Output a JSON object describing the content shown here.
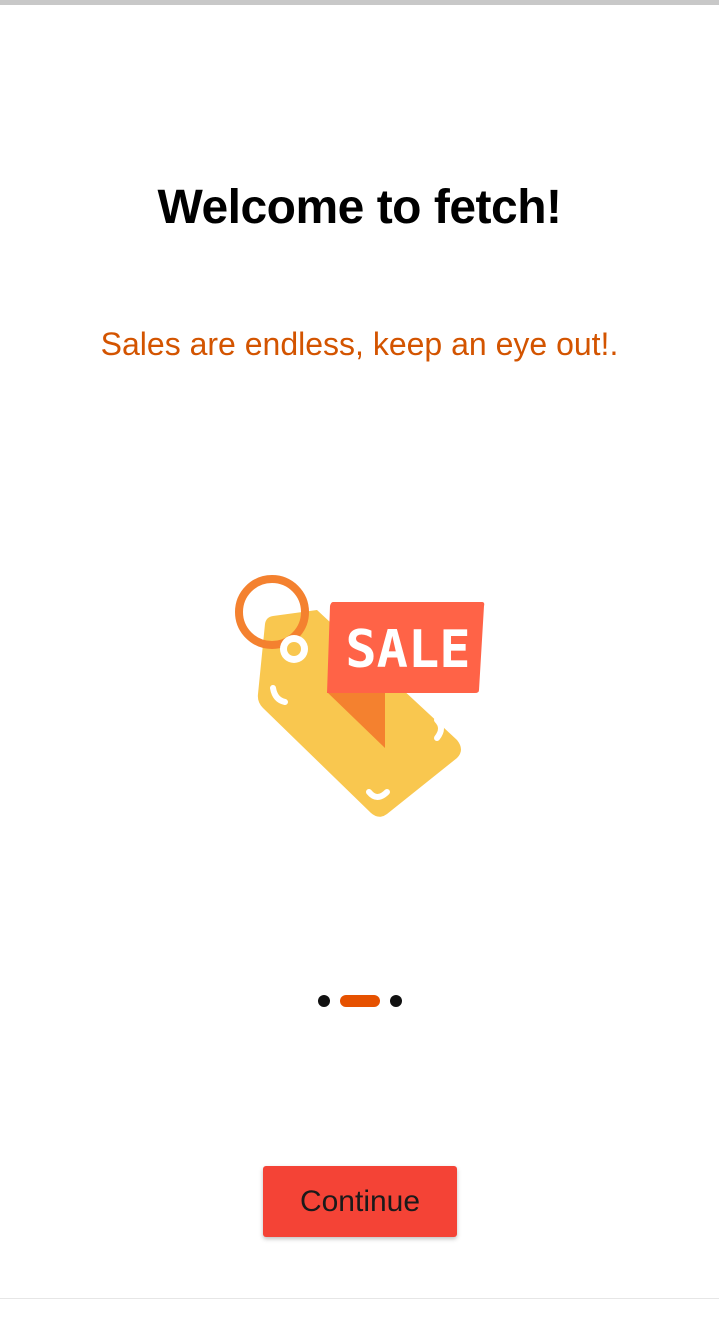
{
  "onboarding": {
    "title": "Welcome to fetch!",
    "subtitle": "Sales are endless, keep an eye out!.",
    "illustration": {
      "icon": "sale-tag-icon",
      "tag_text": "SALE"
    },
    "pager": {
      "total_pages": 3,
      "current_page": 2
    },
    "continue_label": "Continue"
  },
  "colors": {
    "accent_orange": "#e65100",
    "subtitle_orange": "#d35400",
    "button_red": "#f44336",
    "tag_yellow": "#f9c74f",
    "tag_ring_orange": "#f4812f",
    "sale_banner_red": "#ff6347"
  }
}
